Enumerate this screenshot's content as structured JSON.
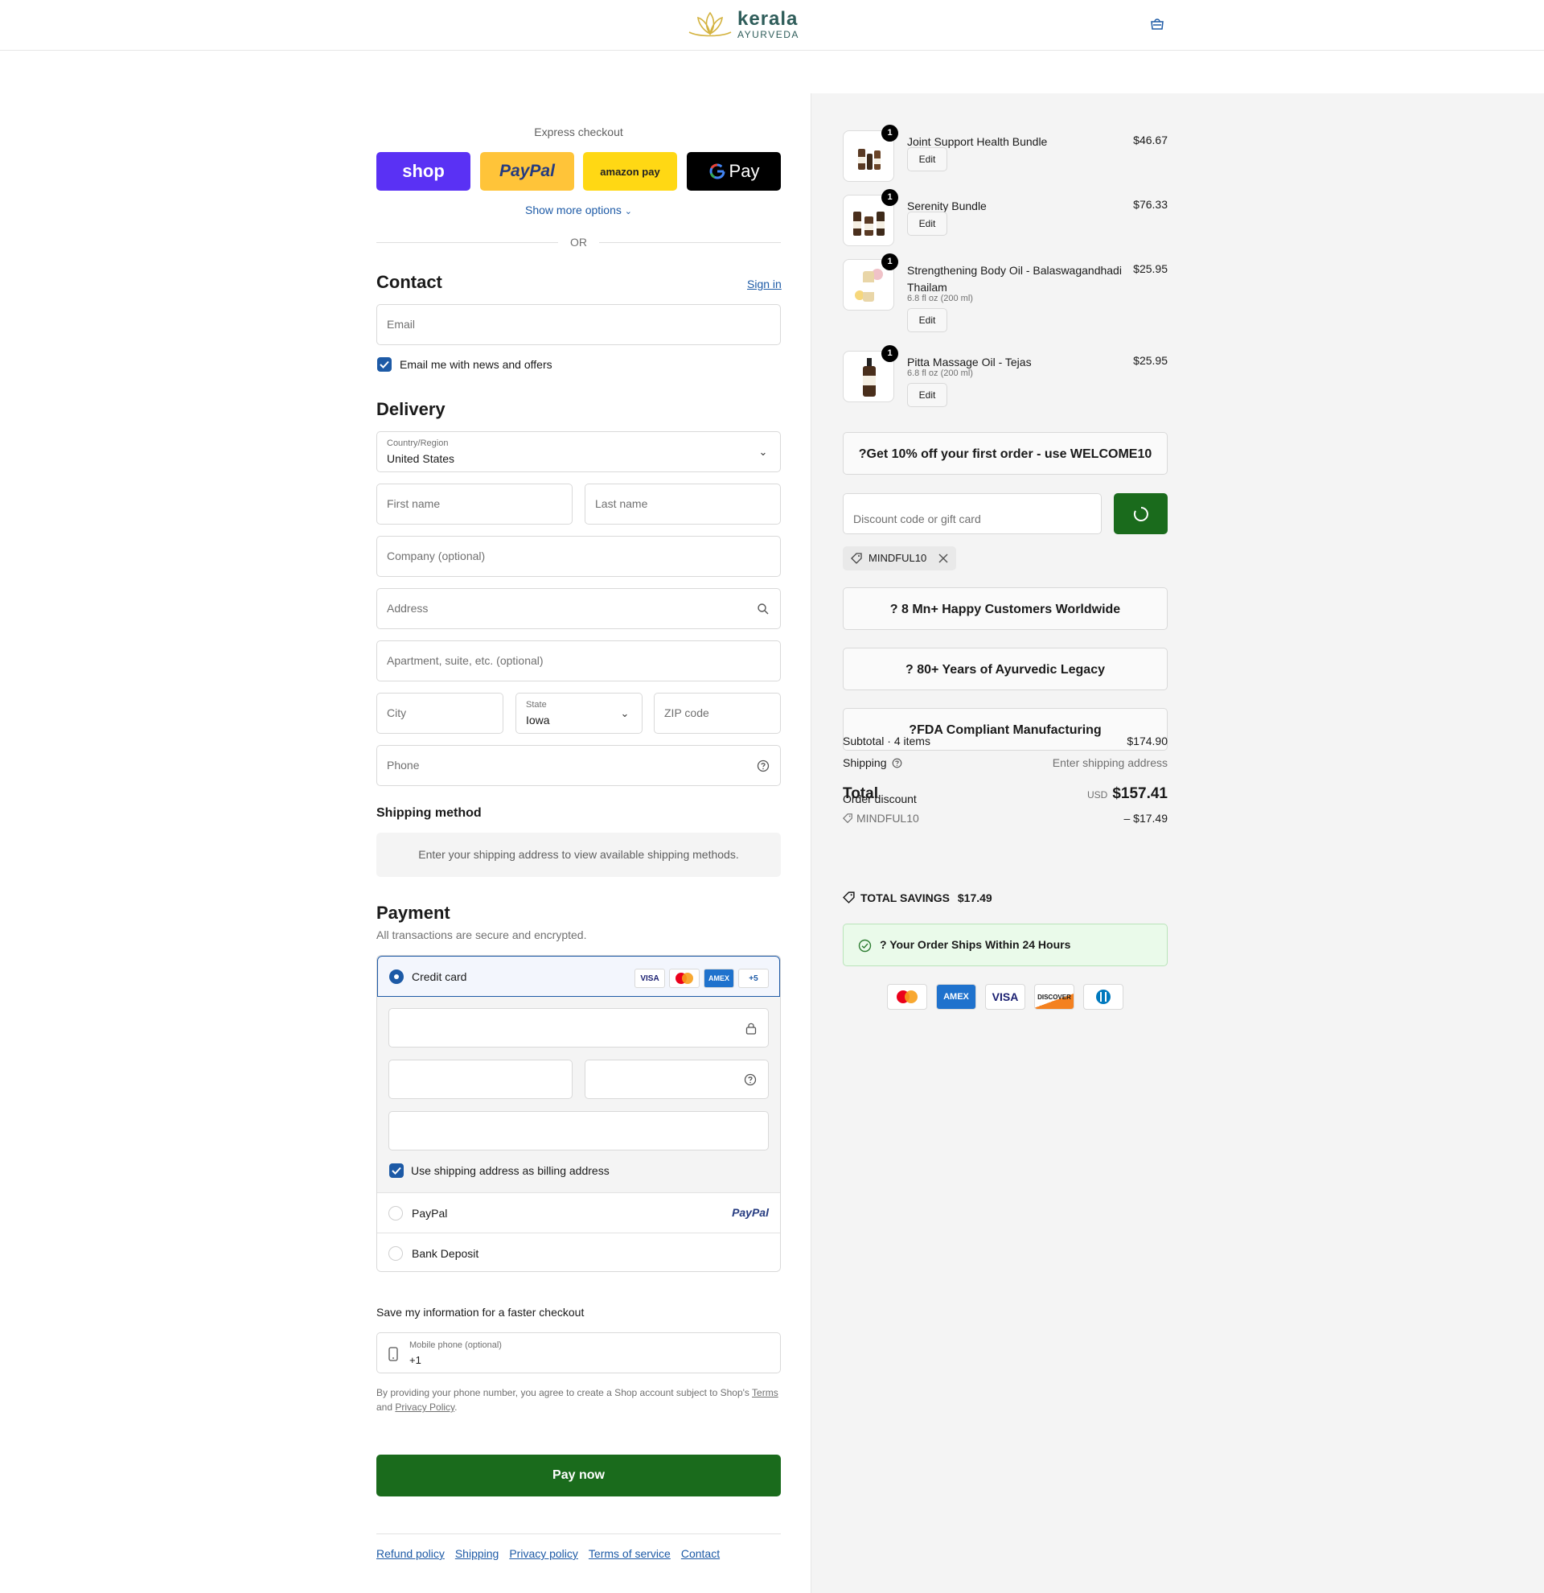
{
  "header": {
    "logo_main": "kerala",
    "logo_sub": "AYURVEDA"
  },
  "express": {
    "label": "Express checkout",
    "buttons": [
      "shop",
      "PayPal",
      "amazon pay",
      "Pay"
    ],
    "show_more": "Show more options",
    "or": "OR"
  },
  "contact": {
    "title": "Contact",
    "sign_in": "Sign in",
    "email_placeholder": "Email",
    "newsletter": "Email me with news and offers"
  },
  "delivery": {
    "title": "Delivery",
    "country_label": "Country/Region",
    "country_value": "United States",
    "first_name": "First name",
    "last_name": "Last name",
    "company": "Company (optional)",
    "address": "Address",
    "apartment": "Apartment, suite, etc. (optional)",
    "city": "City",
    "state_label": "State",
    "state_value": "Iowa",
    "zip": "ZIP code",
    "phone": "Phone"
  },
  "shipping_method": {
    "title": "Shipping method",
    "notice": "Enter your shipping address to view available shipping methods."
  },
  "payment": {
    "title": "Payment",
    "subtitle": "All transactions are secure and encrypted.",
    "credit_card": "Credit card",
    "card_badges": [
      "VISA",
      "",
      "AMEX",
      "+5"
    ],
    "billing_same": "Use shipping address as billing address",
    "paypal": "PayPal",
    "paypal_logo": "PayPal",
    "bank": "Bank Deposit"
  },
  "save_info": {
    "title": "Save my information for a faster checkout",
    "mobile_label": "Mobile phone (optional)",
    "mobile_value": "+1",
    "disclaimer_1": "By providing your phone number, you agree to create a Shop account subject to Shop's",
    "terms": "Terms",
    "and": "and",
    "privacy": "Privacy Policy",
    "period": "."
  },
  "pay_now": "Pay now",
  "footer_links": [
    "Refund policy",
    "Shipping",
    "Privacy policy",
    "Terms of service",
    "Contact"
  ],
  "cart": {
    "items": [
      {
        "name": "Joint Support Health Bundle",
        "variant": "",
        "price": "$46.67",
        "qty": "1",
        "edit": "Edit"
      },
      {
        "name": "Serenity Bundle",
        "variant": "",
        "price": "$76.33",
        "qty": "1",
        "edit": "Edit"
      },
      {
        "name": "Strengthening Body Oil - Balaswagandhadi Thailam",
        "variant": "6.8 fl oz (200 ml)",
        "price": "$25.95",
        "qty": "1",
        "edit": "Edit"
      },
      {
        "name": "Pitta Massage Oil - Tejas",
        "variant": "6.8 fl oz (200 ml)",
        "price": "$25.95",
        "qty": "1",
        "edit": "Edit"
      }
    ],
    "promo_banner": "?Get 10% off your first order - use WELCOME10",
    "discount_placeholder": "Discount code or gift card",
    "applied_code": "MINDFUL10",
    "banner_customers": "? 8 Mn+ Happy Customers Worldwide",
    "banner_years": "? 80+ Years of Ayurvedic Legacy",
    "banner_fda": "?FDA Compliant Manufacturing",
    "subtotal_label": "Subtotal · 4 items",
    "subtotal_value": "$174.90",
    "shipping_label": "Shipping",
    "shipping_value": "Enter shipping address",
    "order_discount_label": "Order discount",
    "discount_code": "MINDFUL10",
    "discount_value": "– $17.49",
    "total_label": "Total",
    "currency": "USD",
    "total_value": "$157.41",
    "savings_label": "TOTAL SAVINGS",
    "savings_value": "$17.49",
    "ships_notice": "? Your Order Ships Within 24 Hours",
    "card_icons": [
      "",
      "AMEX",
      "VISA",
      "DISCOVER",
      ""
    ]
  },
  "colors": {
    "accent": "#1d5aa6",
    "green": "#1a6b1c",
    "shop": "#5a31f4",
    "paypal": "#ffc439",
    "amazon": "#ffd814"
  }
}
